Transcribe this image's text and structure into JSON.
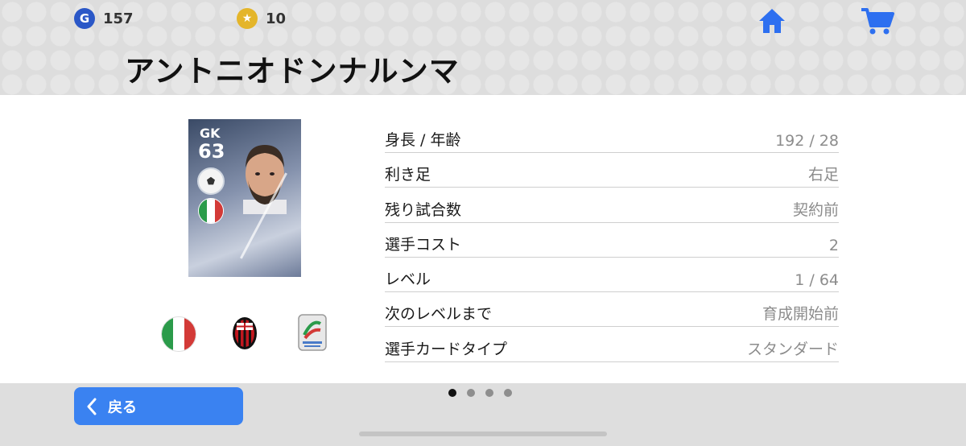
{
  "currency": {
    "gp": {
      "icon": "g-coin-icon",
      "symbol": "G",
      "value": "157"
    },
    "coins": {
      "icon": "star-coin-icon",
      "symbol": "★",
      "value": "10"
    }
  },
  "nav": {
    "home_icon": "home-icon",
    "cart_icon": "cart-icon",
    "accent_color": "#2d6ff0"
  },
  "player": {
    "name": "アントニオドンナルンマ",
    "card": {
      "position": "GK",
      "rating": "63",
      "nationality_flag": "italy-flag-icon"
    }
  },
  "stats": [
    {
      "label": "身長 / 年齢",
      "value": "192 / 28"
    },
    {
      "label": "利き足",
      "value": "右足"
    },
    {
      "label": "残り試合数",
      "value": "契約前"
    },
    {
      "label": "選手コスト",
      "value": "2"
    },
    {
      "label": "レベル",
      "value": "1 / 64"
    },
    {
      "label": "次のレベルまで",
      "value": "育成開始前"
    },
    {
      "label": "選手カードタイプ",
      "value": "スタンダード"
    }
  ],
  "pagination": {
    "total": 4,
    "active": 1
  },
  "back_button": {
    "label": "戻る",
    "icon": "chevron-left-icon",
    "color": "#3a82f1"
  }
}
